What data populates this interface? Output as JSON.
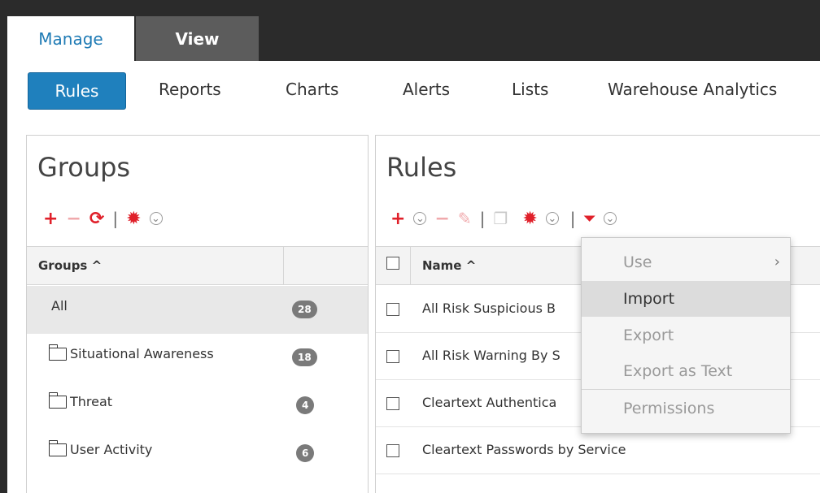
{
  "tabs": {
    "manage": "Manage",
    "view": "View"
  },
  "nav": {
    "rules": "Rules",
    "reports": "Reports",
    "charts": "Charts",
    "alerts": "Alerts",
    "lists": "Lists",
    "warehouse": "Warehouse Analytics"
  },
  "groups_panel": {
    "title": "Groups",
    "header": "Groups ^",
    "items": [
      {
        "label": "All",
        "count": "28"
      },
      {
        "label": "Situational Awareness",
        "count": "18"
      },
      {
        "label": "Threat",
        "count": "4"
      },
      {
        "label": "User Activity",
        "count": "6"
      }
    ]
  },
  "rules_panel": {
    "title": "Rules",
    "header": "Name ^",
    "rows": [
      "All Risk Suspicious B",
      "All Risk Warning By S",
      "Cleartext Authentica",
      "Cleartext Passwords by Service"
    ]
  },
  "menu": {
    "use": "Use",
    "import": "Import",
    "export": "Export",
    "export_text": "Export as Text",
    "permissions": "Permissions"
  },
  "icons": {
    "add": "+",
    "remove": "−",
    "refresh": "⟳",
    "gear": "✹",
    "chevron": "⌄",
    "edit": "✎",
    "copy": "❐",
    "filter": "⏷",
    "separator": "|",
    "submenu": "›"
  },
  "colors": {
    "accent": "#1f80bd",
    "red": "#e0202a",
    "dark": "#2b2b2b"
  }
}
